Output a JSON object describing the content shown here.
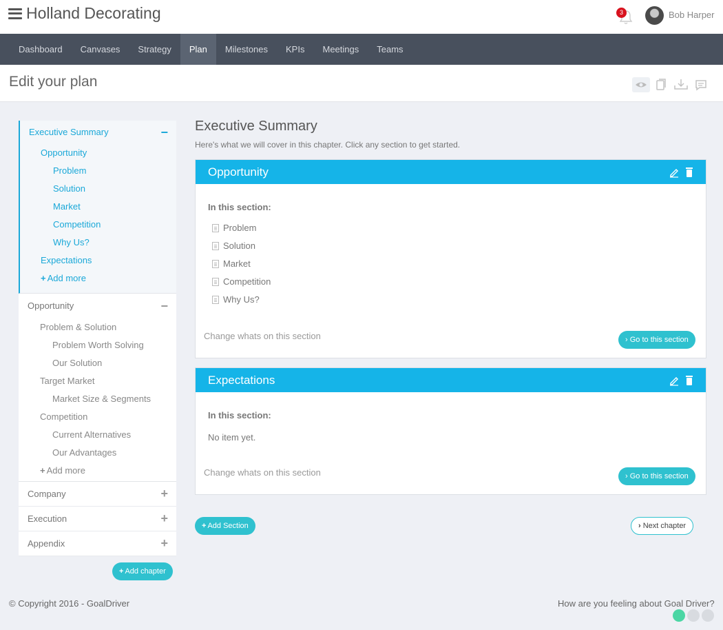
{
  "app": {
    "brand": "Holland Decorating",
    "notifications": "3",
    "user": "Bob Harper"
  },
  "nav": [
    "Dashboard",
    "Canvases",
    "Strategy",
    "Plan",
    "Milestones",
    "KPIs",
    "Meetings",
    "Teams"
  ],
  "nav_active": "Plan",
  "page": {
    "title": "Edit your plan"
  },
  "sidebar": {
    "exec": {
      "title": "Executive Summary",
      "toggle": "−",
      "items": [
        {
          "label": "Opportunity",
          "level": 1
        },
        {
          "label": "Problem",
          "level": 2
        },
        {
          "label": "Solution",
          "level": 2
        },
        {
          "label": "Market",
          "level": 2
        },
        {
          "label": "Competition",
          "level": 2
        },
        {
          "label": "Why Us?",
          "level": 2
        },
        {
          "label": "Expectations",
          "level": 1
        }
      ],
      "add_more": "Add more"
    },
    "opp": {
      "title": "Opportunity",
      "toggle": "−",
      "items": [
        {
          "label": "Problem & Solution",
          "level": 1
        },
        {
          "label": "Problem Worth Solving",
          "level": 2
        },
        {
          "label": "Our Solution",
          "level": 2
        },
        {
          "label": "Target Market",
          "level": 1
        },
        {
          "label": "Market Size & Segments",
          "level": 2
        },
        {
          "label": "Competition",
          "level": 1
        },
        {
          "label": "Current Alternatives",
          "level": 2
        },
        {
          "label": "Our Advantages",
          "level": 2
        }
      ],
      "add_more": "Add more"
    },
    "collapsed": [
      {
        "title": "Company",
        "toggle": "+"
      },
      {
        "title": "Execution",
        "toggle": "+"
      },
      {
        "title": "Appendix",
        "toggle": "+"
      }
    ],
    "add_chapter": "Add chapter"
  },
  "main": {
    "title": "Executive Summary",
    "description": "Here's what we will cover in this chapter. Click any section to get started.",
    "cards": [
      {
        "title": "Opportunity",
        "in_section_label": "In this section:",
        "items": [
          "Problem",
          "Solution",
          "Market",
          "Competition",
          "Why Us?"
        ],
        "change_link": "Change whats on this section",
        "goto": "Go to this section"
      },
      {
        "title": "Expectations",
        "in_section_label": "In this section:",
        "empty": "No item yet.",
        "change_link": "Change whats on this section",
        "goto": "Go to this section"
      }
    ],
    "add_section": "Add Section",
    "next_chapter": "Next chapter"
  },
  "footer": {
    "copyright": "© Copyright 2016 - GoalDriver",
    "question": "How are you feeling about Goal Driver?"
  },
  "colors": {
    "accent": "#15b4e8",
    "button": "#2fc1cf",
    "nav_bg": "#48505d",
    "badge": "#d8121e"
  }
}
